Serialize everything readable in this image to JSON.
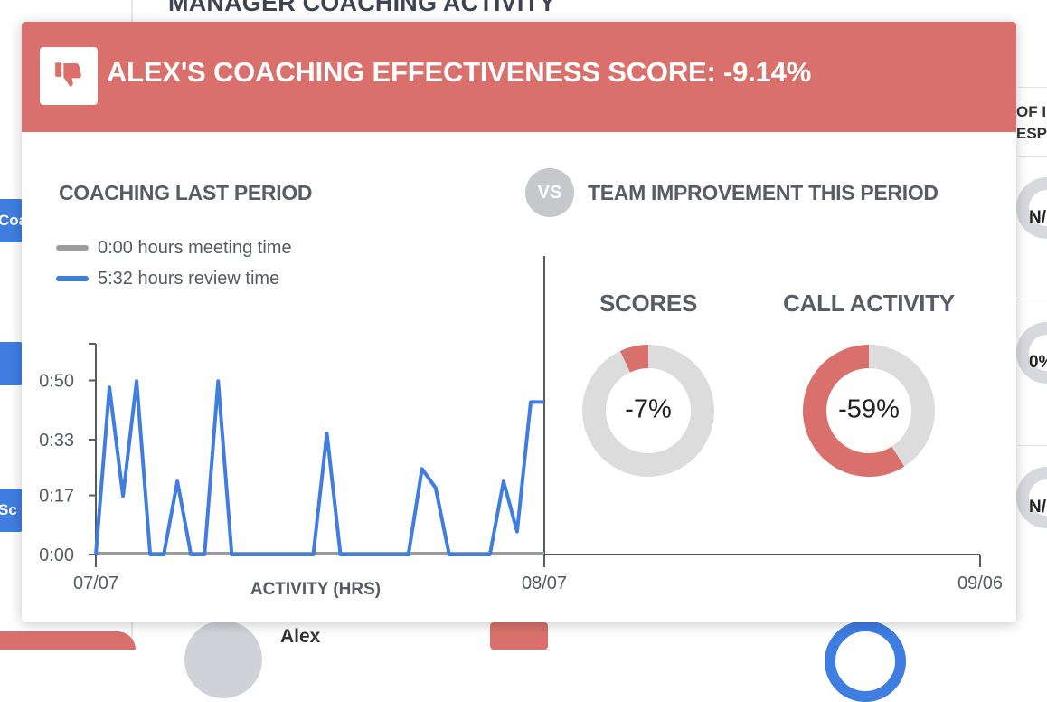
{
  "background": {
    "page_title": "MANAGER COACHING ACTIVITY",
    "left_tabs": [
      "Coa",
      "Sc"
    ],
    "right_header": "OF I\nESPO",
    "right_values": [
      "N/",
      "0%",
      "N/"
    ],
    "bottom_name": "Alex"
  },
  "modal": {
    "header_title": "ALEX'S COACHING EFFECTIVENESS SCORE: -9.14%",
    "header_icon": "thumbs-down-icon",
    "header_color": "#d9706b",
    "left_section_title": "COACHING LAST PERIOD",
    "vs_label": "VS",
    "right_section_title": "TEAM IMPROVEMENT THIS PERIOD",
    "legend": [
      {
        "label": "0:00 hours meeting time",
        "color": "#9b9b9b"
      },
      {
        "label": "5:32 hours review time",
        "color": "#3f7de0"
      }
    ],
    "donuts": [
      {
        "title": "SCORES",
        "value_label": "-7%",
        "value": -7,
        "color": "#d9706b",
        "track": "#dcdcdc"
      },
      {
        "title": "CALL ACTIVITY",
        "value_label": "-59%",
        "value": -59,
        "color": "#d9706b",
        "track": "#dcdcdc"
      }
    ]
  },
  "chart_data": {
    "type": "line",
    "xlabel": "ACTIVITY (HRS)",
    "x_tick_labels": [
      "07/07",
      "08/07",
      "09/06"
    ],
    "y_tick_labels": [
      "0:00",
      "0:17",
      "0:33",
      "0:50"
    ],
    "ylim_hours": [
      0,
      1.0
    ],
    "y_ticks_hours": [
      0,
      0.2833,
      0.55,
      0.8333
    ],
    "x_divider_label": "08/07",
    "series": [
      {
        "name": "review time",
        "color": "#3f7de0",
        "values_hours": [
          0,
          0.8,
          0.28,
          0.83,
          0,
          0,
          0.35,
          0,
          0,
          0.83,
          0,
          0,
          0,
          0,
          0,
          0,
          0,
          0.58,
          0,
          0,
          0,
          0,
          0,
          0,
          0.41,
          0.32,
          0,
          0,
          0,
          0,
          0.35,
          0.11,
          0.73,
          0.73
        ]
      },
      {
        "name": "meeting time",
        "color": "#9b9b9b",
        "values_hours": [
          0,
          0
        ]
      }
    ]
  }
}
